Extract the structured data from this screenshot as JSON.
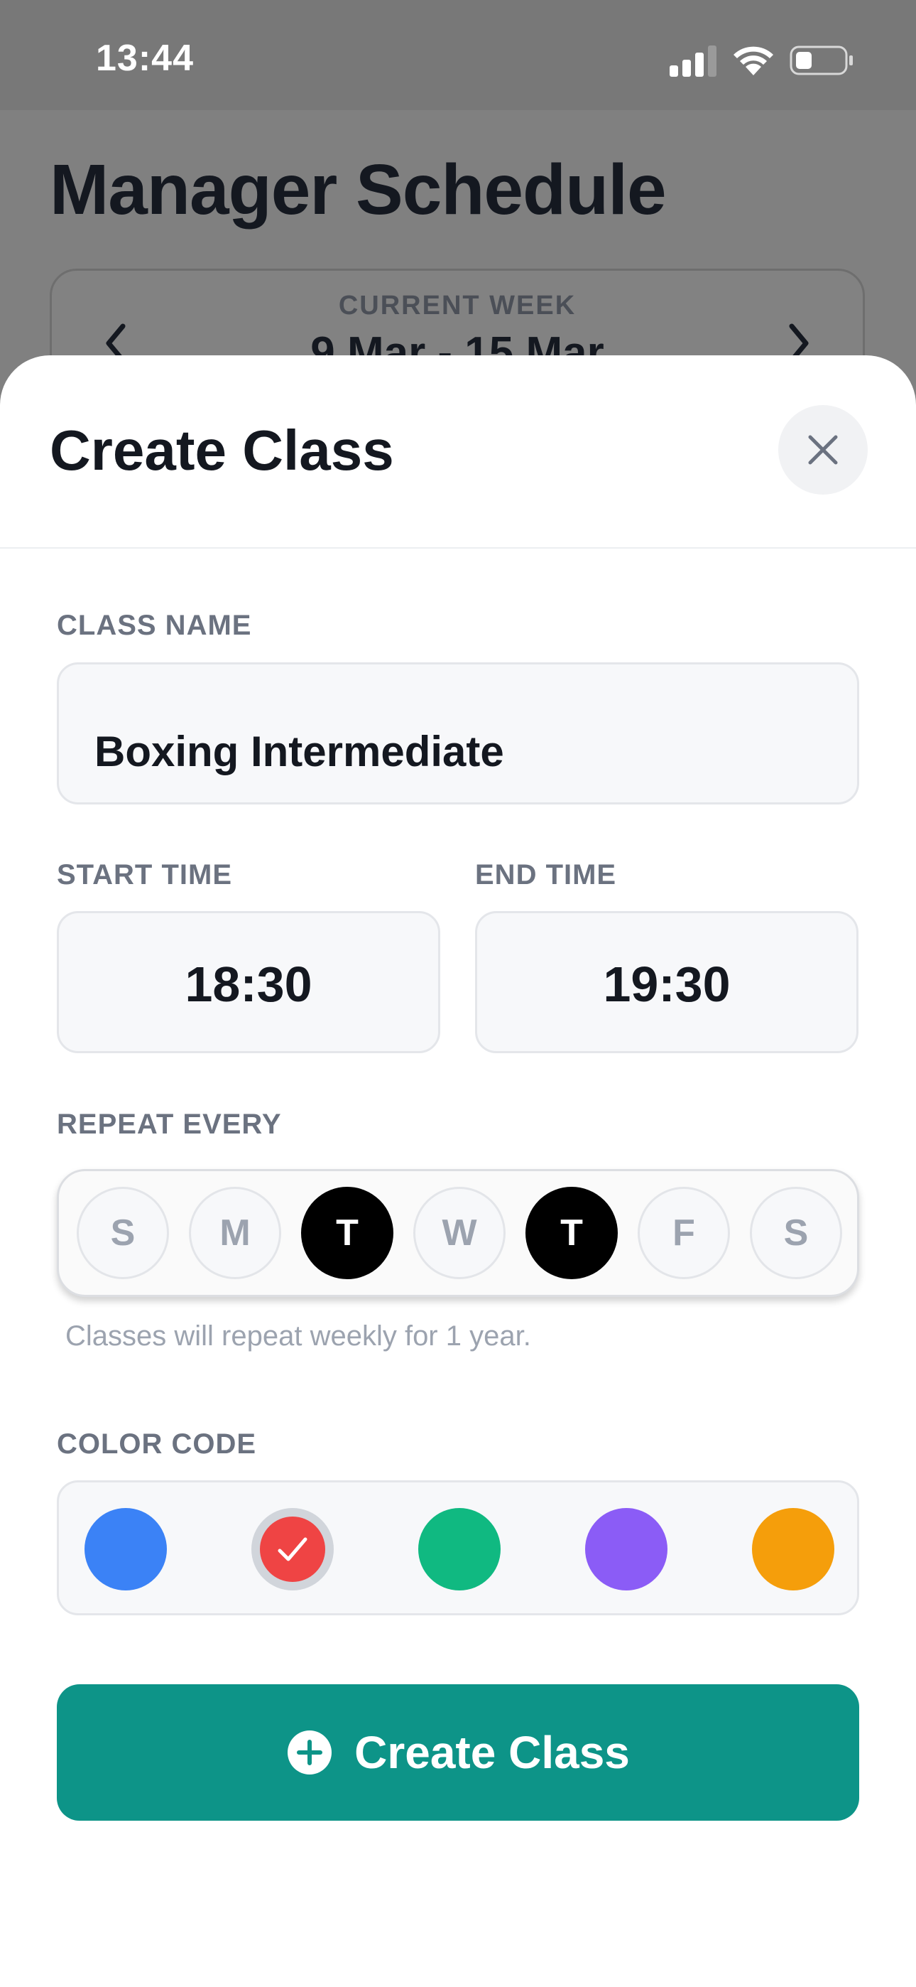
{
  "status_bar": {
    "time": "13:44",
    "icons": [
      "signal-icon",
      "wifi-icon",
      "battery-icon"
    ]
  },
  "background": {
    "title": "Manager Schedule",
    "week_label": "CURRENT WEEK",
    "week_range": "9 Mar - 15 Mar"
  },
  "sheet": {
    "title": "Create Class",
    "close_icon": "close-icon"
  },
  "form": {
    "class_name_label": "CLASS NAME",
    "class_name_value": "Boxing Intermediate",
    "start_time_label": "START TIME",
    "start_time_value": "18:30",
    "end_time_label": "END TIME",
    "end_time_value": "19:30",
    "repeat_label": "REPEAT EVERY",
    "days": [
      {
        "letter": "S",
        "selected": false
      },
      {
        "letter": "M",
        "selected": false
      },
      {
        "letter": "T",
        "selected": true
      },
      {
        "letter": "W",
        "selected": false
      },
      {
        "letter": "T",
        "selected": true
      },
      {
        "letter": "F",
        "selected": false
      },
      {
        "letter": "S",
        "selected": false
      }
    ],
    "repeat_note": "Classes will repeat weekly for 1 year.",
    "color_label": "COLOR CODE",
    "colors": [
      {
        "hex": "#3b82f6",
        "selected": false
      },
      {
        "hex": "#ef4444",
        "selected": true
      },
      {
        "hex": "#10b981",
        "selected": false
      },
      {
        "hex": "#8b5cf6",
        "selected": false
      },
      {
        "hex": "#f59e0b",
        "selected": false
      }
    ],
    "submit_label": "Create Class",
    "submit_icon": "plus-circle-icon"
  },
  "theme": {
    "accent": "#0d9488",
    "text_dark": "#141820",
    "label_gray": "#6b7280"
  }
}
